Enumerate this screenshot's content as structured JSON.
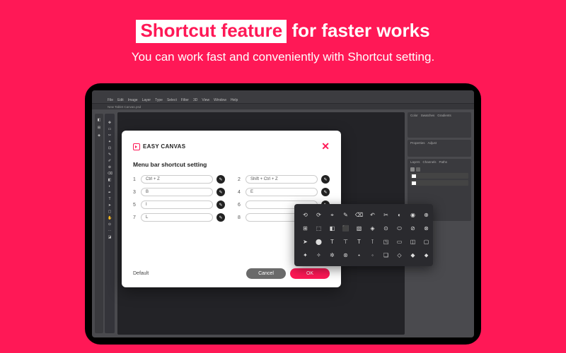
{
  "hero": {
    "highlight": "Shortcut feature",
    "rest": " for faster works",
    "sub": "You can work fast and conveniently with Shortcut setting."
  },
  "editor": {
    "menu": [
      "File",
      "Edit",
      "Image",
      "Layer",
      "Type",
      "Select",
      "Filter",
      "3D",
      "View",
      "Window",
      "Help"
    ],
    "tab": "New Tablet Canvas.psd"
  },
  "right_panels": {
    "tabs1": [
      "Color",
      "Swatches",
      "Gradients"
    ],
    "tabs2": [
      "Properties",
      "Adjust"
    ],
    "tabs3": [
      "Layers",
      "Channels",
      "Paths"
    ]
  },
  "dialog": {
    "brand": "EASY CANVAS",
    "title": "Menu bar shortcut setting",
    "default": "Default",
    "cancel": "Cancel",
    "ok": "OK",
    "rows": [
      {
        "n": "1",
        "v": "Ctrl + Z"
      },
      {
        "n": "2",
        "v": "Shift + Ctrl + Z"
      },
      {
        "n": "3",
        "v": "B"
      },
      {
        "n": "4",
        "v": "E"
      },
      {
        "n": "5",
        "v": "I"
      },
      {
        "n": "6",
        "v": ""
      },
      {
        "n": "7",
        "v": "L"
      },
      {
        "n": "8",
        "v": ""
      }
    ]
  },
  "picker": {
    "glyphs": [
      "⟲",
      "⟳",
      "⌖",
      "✎",
      "⌫",
      "↶",
      "✂",
      "◐",
      "◉",
      "⊕",
      "⊞",
      "⬚",
      "◧",
      "⬛",
      "▧",
      "◈",
      "⊙",
      "⬭",
      "⊘",
      "⊗",
      "➤",
      "⬤",
      "T",
      "⊤",
      "T",
      "⊺",
      "◳",
      "▭",
      "◫",
      "▢",
      "✦",
      "✧",
      "✲",
      "⊛",
      "⋆",
      "◦",
      "❏",
      "◇",
      "◆",
      "⬥"
    ]
  }
}
